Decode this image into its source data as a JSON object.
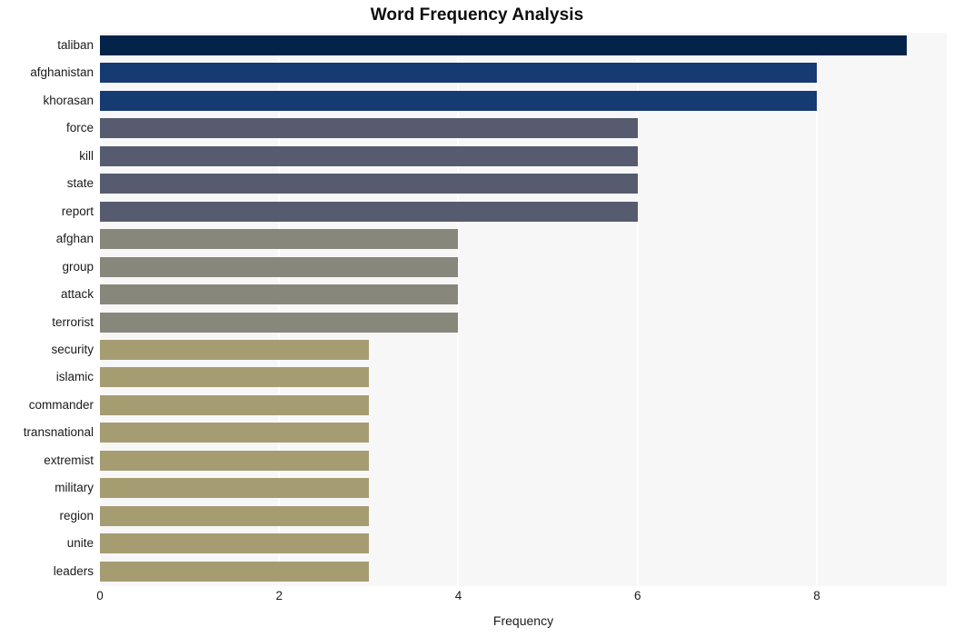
{
  "chart_data": {
    "type": "bar",
    "orientation": "horizontal",
    "title": "Word Frequency Analysis",
    "xlabel": "Frequency",
    "ylabel": "",
    "categories": [
      "taliban",
      "afghanistan",
      "khorasan",
      "force",
      "kill",
      "state",
      "report",
      "afghan",
      "group",
      "attack",
      "terrorist",
      "security",
      "islamic",
      "commander",
      "transnational",
      "extremist",
      "military",
      "region",
      "unite",
      "leaders"
    ],
    "values": [
      9,
      8,
      8,
      6,
      6,
      6,
      6,
      4,
      4,
      4,
      4,
      3,
      3,
      3,
      3,
      3,
      3,
      3,
      3,
      3
    ],
    "bar_colors": [
      "#042349",
      "#163a72",
      "#163a72",
      "#565b6f",
      "#565b6f",
      "#565b6f",
      "#565b6f",
      "#88877c",
      "#88877c",
      "#88877c",
      "#88877c",
      "#a69c72",
      "#a69c72",
      "#a69c72",
      "#a69c72",
      "#a69c72",
      "#a69c72",
      "#a69c72",
      "#a69c72",
      "#a69c72"
    ],
    "xlim": [
      0,
      9.45
    ],
    "ylim_categories": 20,
    "xticks": [
      0,
      2,
      4,
      6,
      8
    ],
    "xtick_labels": [
      "0",
      "2",
      "4",
      "6",
      "8"
    ],
    "gridlines": {
      "vertical": true,
      "horizontal": false,
      "color": "#ffffff"
    },
    "plot_background": "#f7f7f8",
    "figure_background": "#ffffff",
    "legend": null
  }
}
